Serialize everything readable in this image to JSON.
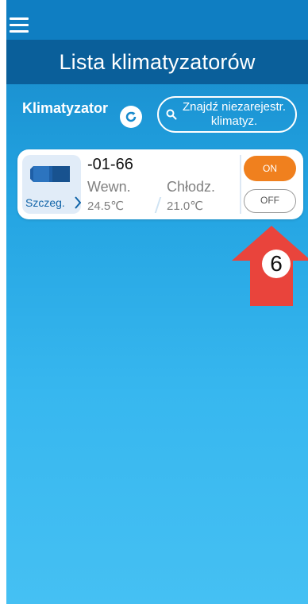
{
  "header": {
    "menu_icon": "hamburger-menu-icon",
    "title": "Lista klimatyzatorów"
  },
  "toolbar": {
    "section_label": "Klimatyzator",
    "refresh_icon": "refresh-icon",
    "search_icon": "search-icon",
    "search_label_line1": "Znajdź niezarejestr.",
    "search_label_line2": "klimatyz."
  },
  "units": [
    {
      "name": "-01-66",
      "details_label": "Szczeg.",
      "room_label": "Wewn.",
      "mode_label": "Chłodz.",
      "room_temp": "24.5℃",
      "set_temp": "21.0℃",
      "on_label": "ON",
      "off_label": "OFF",
      "icon": "air-conditioner-icon"
    }
  ],
  "annotation": {
    "step_number": "6",
    "color": "#e9443c"
  },
  "colors": {
    "title_bar": "#0a5f9a",
    "top_bar": "#0f7ec2",
    "on_button": "#f0801e",
    "details_text": "#1164a8"
  }
}
